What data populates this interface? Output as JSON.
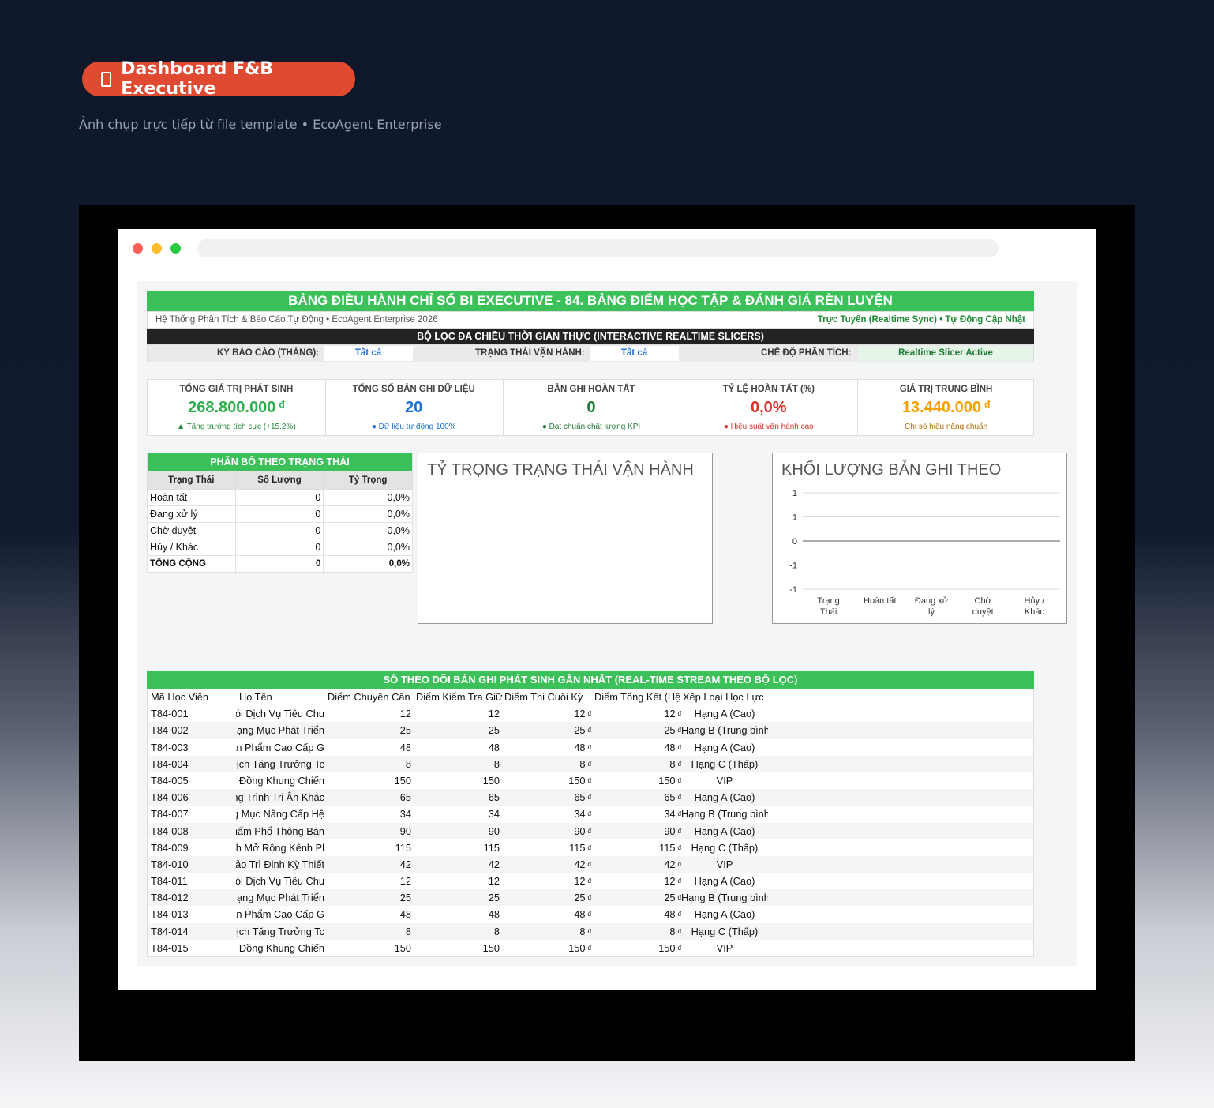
{
  "hero": {
    "badge_icon": "document-icon",
    "badge_text": "Dashboard F&B Executive",
    "subtitle": "Ảnh chụp trực tiếp từ file template • EcoAgent Enterprise"
  },
  "browser": {
    "dot_colors": [
      "#ff5f57",
      "#febc2e",
      "#28c840"
    ]
  },
  "sheet": {
    "title": "BẢNG ĐIỀU HÀNH CHỈ SỐ BI EXECUTIVE - 84. BẢNG ĐIỂM HỌC TẬP & ĐÁNH GIÁ RÈN LUYỆN",
    "meta_left": "Hệ Thống Phân Tích & Báo Cáo Tự Động • EcoAgent Enterprise 2026",
    "meta_right": "Trực Tuyến (Realtime Sync) • Tự Động Cập Nhật",
    "slicer_title": "BỘ LỌC ĐA CHIỀU THỜI GIAN THỰC (INTERACTIVE REALTIME SLICERS)",
    "filters": {
      "period_label": "KỲ BÁO CÁO (THÁNG):",
      "period_value": "Tất cả",
      "status_label": "TRẠNG THÁI VẬN HÀNH:",
      "status_value": "Tất cả",
      "mode_label": "CHẾ ĐỘ PHÂN TÍCH:",
      "mode_value": "Realtime Slicer Active"
    },
    "kpis": [
      {
        "label": "TỔNG GIÁ TRỊ PHÁT SINH",
        "value": "268.800.000",
        "currency": "đ",
        "note": "▲ Tăng trưởng tích cực (+15.2%)",
        "color": "#2fae4e",
        "note_color": "#1f8a34"
      },
      {
        "label": "TỔNG SỐ BẢN GHI DỮ LIỆU",
        "value": "20",
        "currency": "",
        "note": "● Dữ liệu tự động 100%",
        "color": "#1a6fd6",
        "note_color": "#1a6fd6"
      },
      {
        "label": "BẢN GHI HOÀN TẤT",
        "value": "0",
        "currency": "",
        "note": "● Đạt chuẩn chất lượng KPI",
        "color": "#1f7a34",
        "note_color": "#1f7a34"
      },
      {
        "label": "TỶ LỆ HOÀN TẤT (%)",
        "value": "0,0%",
        "currency": "",
        "note": "● Hiệu suất vận hành cao",
        "color": "#d8322a",
        "note_color": "#d8322a"
      },
      {
        "label": "GIÁ TRỊ TRUNG BÌNH",
        "value": "13.440.000",
        "currency": "đ",
        "note": "Chỉ số hiệu năng chuẩn",
        "color": "#f5a000",
        "note_color": "#b86a00"
      }
    ],
    "distribution": {
      "title": "PHÂN BỔ THEO TRẠNG THÁI",
      "headers": [
        "Trạng Thái",
        "Số Lượng",
        "Tỷ Trọng"
      ],
      "rows": [
        [
          "Hoàn tất",
          "0",
          "0,0%"
        ],
        [
          "Đang xử lý",
          "0",
          "0,0%"
        ],
        [
          "Chờ duyệt",
          "0",
          "0,0%"
        ],
        [
          "Hủy / Khác",
          "0",
          "0,0%"
        ]
      ],
      "total": [
        "TỔNG CỘNG",
        "0",
        "0,0%"
      ]
    },
    "pie_chart_title": "TỶ TRỌNG TRẠNG THÁI VẬN HÀNH",
    "feed": {
      "title": "SỔ THEO DÕI BẢN GHI PHÁT SINH GẦN NHẤT (REAL-TIME STREAM THEO BỘ LỌC)",
      "headers": [
        "Mã Học Viên",
        "Họ Tên",
        "Điểm Chuyên Cần",
        "Điểm Kiểm Tra Giữ",
        "Điểm Thi Cuối Kỳ",
        "Điểm Tổng Kết (Hệ",
        "Xếp Loại Học Lực"
      ],
      "currency": "đ",
      "rows": [
        [
          "T84-001",
          "Gói Dịch Vụ Tiêu Chu",
          "12",
          "12",
          "12",
          "12",
          "Hạng A (Cao)"
        ],
        [
          "T84-002",
          "Hạng Mục Phát Triển (",
          "25",
          "25",
          "25",
          "25",
          "Hạng B (Trung bình)"
        ],
        [
          "T84-003",
          "Sản Phẩm Cao Cấp G",
          "48",
          "48",
          "48",
          "48",
          "Hạng A (Cao)"
        ],
        [
          "T84-004",
          "Dịch Tăng Trưởng Tc",
          "8",
          "8",
          "8",
          "8",
          "Hạng C (Thấp)"
        ],
        [
          "T84-005",
          "Hợp Đồng Khung Chiến",
          "150",
          "150",
          "150",
          "150",
          "VIP"
        ],
        [
          "T84-006",
          "ng Trình Tri Ân Khác",
          "65",
          "65",
          "65",
          "65",
          "Hạng A (Cao)"
        ],
        [
          "T84-007",
          "Hạng Mục Nâng Cấp Hệ",
          "34",
          "34",
          "34",
          "34",
          "Hạng B (Trung bình)"
        ],
        [
          "T84-008",
          "Ấn Phẩm Phổ Thông Bán",
          "90",
          "90",
          "90",
          "90",
          "Hạng A (Cao)"
        ],
        [
          "T84-009",
          "Kênh Mở Rộng Kênh Pl",
          "115",
          "115",
          "115",
          "115",
          "Hạng C (Thấp)"
        ],
        [
          "T84-010",
          "Bảo Trì Định Kỳ Thiết",
          "42",
          "42",
          "42",
          "42",
          "VIP"
        ],
        [
          "T84-011",
          "Gói Dịch Vụ Tiêu Chu",
          "12",
          "12",
          "12",
          "12",
          "Hạng A (Cao)"
        ],
        [
          "T84-012",
          "Hạng Mục Phát Triển (",
          "25",
          "25",
          "25",
          "25",
          "Hạng B (Trung bình)"
        ],
        [
          "T84-013",
          "Sản Phẩm Cao Cấp G",
          "48",
          "48",
          "48",
          "48",
          "Hạng A (Cao)"
        ],
        [
          "T84-014",
          "Dịch Tăng Trưởng Tc",
          "8",
          "8",
          "8",
          "8",
          "Hạng C (Thấp)"
        ],
        [
          "T84-015",
          "Hợp Đồng Khung Chiến",
          "150",
          "150",
          "150",
          "150",
          "VIP"
        ]
      ]
    }
  },
  "chart_data": {
    "type": "bar",
    "title": "KHỐI LƯỢNG BẢN GHI THEO",
    "categories": [
      "Trạng Thái",
      "Hoàn tất",
      "Đang xử lý",
      "Chờ duyệt",
      "Hủy / Khác"
    ],
    "values": [
      0,
      0,
      0,
      0,
      0
    ],
    "ylim": [
      -1,
      1
    ],
    "ytick_labels": [
      "1",
      "1",
      "0",
      "-1",
      "-1"
    ],
    "grid": true
  }
}
